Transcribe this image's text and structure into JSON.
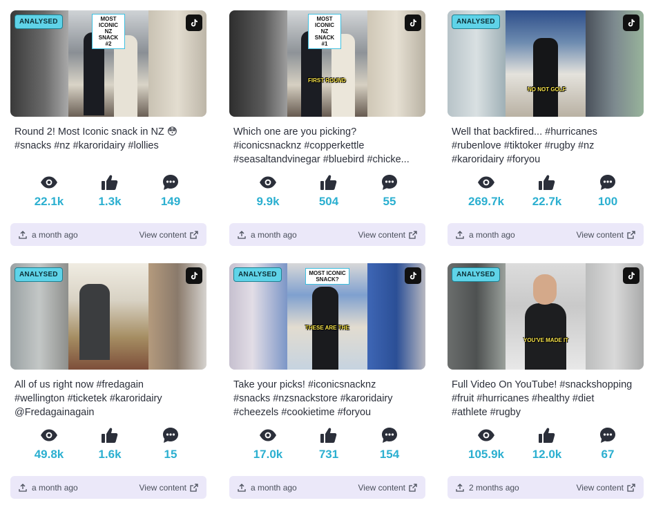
{
  "colors": {
    "accent": "#2bafd0",
    "badge": "#5fd3e8",
    "footer_bg": "#ebe8f9"
  },
  "icons": [
    "eye-icon",
    "thumbs-up-icon",
    "comment-icon",
    "upload-icon",
    "external-link-icon",
    "tiktok-icon"
  ],
  "cards": [
    {
      "badge": "ANALYSED",
      "overlay": "MOST ICONIC NZ SNACK #2",
      "overlay2": "",
      "caption_lines": [
        "Round 2! Most Iconic snack in NZ 😳",
        "#snacks #nz #karoridairy #lollies"
      ],
      "views": "22.1k",
      "likes": "1.3k",
      "comments": "149",
      "posted": "a month ago",
      "view_label": "View content"
    },
    {
      "badge": "",
      "overlay": "MOST ICONIC NZ SNACK #1",
      "overlay2": "FIRST ROUND",
      "caption_lines": [
        "Which one are you picking?",
        "#iconicsnacknz #copperkettle",
        "#seasaltandvinegar #bluebird #chicke..."
      ],
      "views": "9.9k",
      "likes": "504",
      "comments": "55",
      "posted": "a month ago",
      "view_label": "View content"
    },
    {
      "badge": "ANALYSED",
      "overlay": "",
      "overlay2": "NO NOT GOLF",
      "caption_lines": [
        "Well that backfired... #hurricanes",
        "#rubenlove #tiktoker #rugby #nz",
        "#karoridairy #foryou"
      ],
      "views": "269.7k",
      "likes": "22.7k",
      "comments": "100",
      "posted": "a month ago",
      "view_label": "View content"
    },
    {
      "badge": "ANALYSED",
      "overlay": "",
      "overlay2": "",
      "caption_lines": [
        "All of us right now #fredagain",
        "#wellington #ticketek #karoridairy",
        "@Fredagainagain"
      ],
      "views": "49.8k",
      "likes": "1.6k",
      "comments": "15",
      "posted": "a month ago",
      "view_label": "View content"
    },
    {
      "badge": "ANALYSED",
      "overlay": "MOST ICONIC SNACK?",
      "overlay2": "THESE ARE THE",
      "caption_lines": [
        "Take your picks! #iconicsnacknz",
        "#snacks #nzsnackstore #karoridairy",
        "#cheezels #cookietime #foryou"
      ],
      "views": "17.0k",
      "likes": "731",
      "comments": "154",
      "posted": "a month ago",
      "view_label": "View content"
    },
    {
      "badge": "ANALYSED",
      "overlay": "",
      "overlay2": "YOU'VE MADE IT",
      "caption_lines": [
        "Full Video On YouTube! #snackshopping",
        "#fruit #hurricanes #healthy #diet",
        "#athlete #rugby"
      ],
      "views": "105.9k",
      "likes": "12.0k",
      "comments": "67",
      "posted": "2 months ago",
      "view_label": "View content"
    }
  ]
}
